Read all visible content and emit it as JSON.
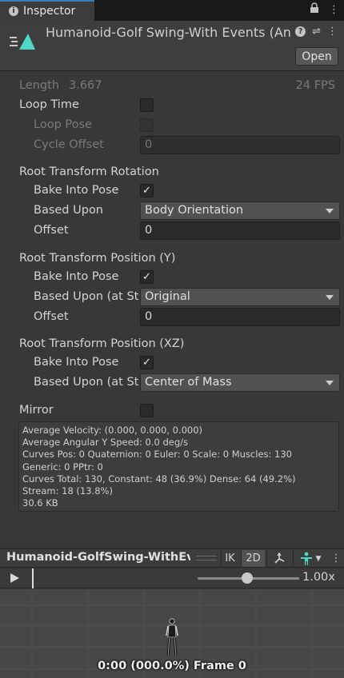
{
  "tab": {
    "label": "Inspector",
    "icon": "info-icon"
  },
  "header": {
    "title": "Humanoid-Golf Swing-With Events (An",
    "open_label": "Open"
  },
  "summary": {
    "length_label": "Length",
    "length_value": "3.667",
    "fps": "24 FPS"
  },
  "loop_time": {
    "label": "Loop Time",
    "checked": false
  },
  "loop_pose": {
    "label": "Loop Pose",
    "checked": false
  },
  "cycle_offset": {
    "label": "Cycle Offset",
    "value": "0"
  },
  "rotation": {
    "heading": "Root Transform Rotation",
    "bake_label": "Bake Into Pose",
    "bake_checked": true,
    "based_label": "Based Upon",
    "based_value": "Body Orientation",
    "offset_label": "Offset",
    "offset_value": "0"
  },
  "position_y": {
    "heading": "Root Transform Position (Y)",
    "bake_label": "Bake Into Pose",
    "bake_checked": true,
    "based_label": "Based Upon (at St",
    "based_value": "Original",
    "offset_label": "Offset",
    "offset_value": "0"
  },
  "position_xz": {
    "heading": "Root Transform Position (XZ)",
    "bake_label": "Bake Into Pose",
    "bake_checked": true,
    "based_label": "Based Upon (at St",
    "based_value": "Center of Mass"
  },
  "mirror": {
    "label": "Mirror",
    "checked": false
  },
  "info_lines": [
    "Average Velocity: (0.000, 0.000, 0.000)",
    "Average Angular Y Speed: 0.0 deg/s",
    "Curves Pos: 0 Quaternion: 0 Euler: 0 Scale: 0 Muscles: 130",
    "Generic: 0 PPtr: 0",
    "Curves Total: 130, Constant: 48 (36.9%) Dense: 64 (49.2%)",
    "Stream: 18 (13.8%)",
    "30.6 KB"
  ],
  "preview": {
    "title": "Humanoid-GolfSwing-WithEve",
    "ik_label": "IK",
    "mode_label": "2D",
    "speed": "1.00x",
    "speed_fraction": 0.48,
    "frame_label": "0:00 (000.0%) Frame 0"
  },
  "colors": {
    "accent": "#3a79bb",
    "avatar": "#4fd8c8",
    "panel": "#383838"
  }
}
